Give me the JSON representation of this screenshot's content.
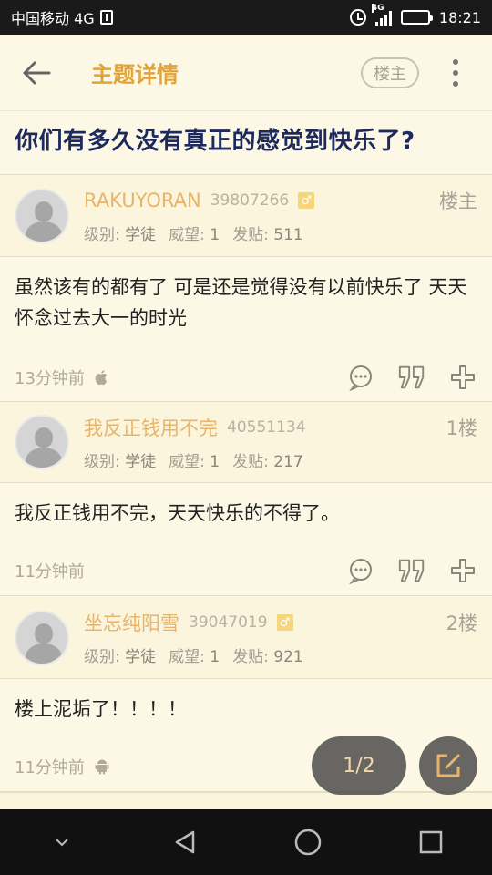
{
  "status_bar": {
    "carrier": "中国移动 4G",
    "network_tag": "4G",
    "time": "18:21"
  },
  "header": {
    "title": "主题详情",
    "owner_filter_label": "楼主"
  },
  "topic": {
    "title": "你们有多久没有真正的感觉到快乐了?"
  },
  "posts": [
    {
      "username": "RAKUYORAN",
      "uid": "39807266",
      "gender": "♂",
      "floor": "楼主",
      "level_label": "级别:",
      "level": "学徒",
      "prestige_label": "威望:",
      "prestige": "1",
      "posts_label": "发贴:",
      "posts": "511",
      "content": "虽然该有的都有了 可是还是觉得没有以前快乐了 天天怀念过去大一的时光",
      "time": "13分钟前",
      "platform": "apple-icon"
    },
    {
      "username": "我反正钱用不完",
      "uid": "40551134",
      "gender": "",
      "floor": "1楼",
      "level_label": "级别:",
      "level": "学徒",
      "prestige_label": "威望:",
      "prestige": "1",
      "posts_label": "发贴:",
      "posts": "217",
      "content": "我反正钱用不完，天天快乐的不得了。",
      "time": "11分钟前",
      "platform": ""
    },
    {
      "username": "坐忘纯阳雪",
      "uid": "39047019",
      "gender": "♂",
      "floor": "2楼",
      "level_label": "级别:",
      "level": "学徒",
      "prestige_label": "威望:",
      "prestige": "1",
      "posts_label": "发贴:",
      "posts": "921",
      "content": "楼上泥垢了！！！！",
      "time": "11分钟前",
      "platform": "android-icon"
    }
  ],
  "pager": {
    "label": "1/2"
  },
  "colors": {
    "accent": "#e0a43a",
    "username": "#e8b46a",
    "background": "#fdf8e6",
    "topic_title": "#1f2a5c"
  }
}
